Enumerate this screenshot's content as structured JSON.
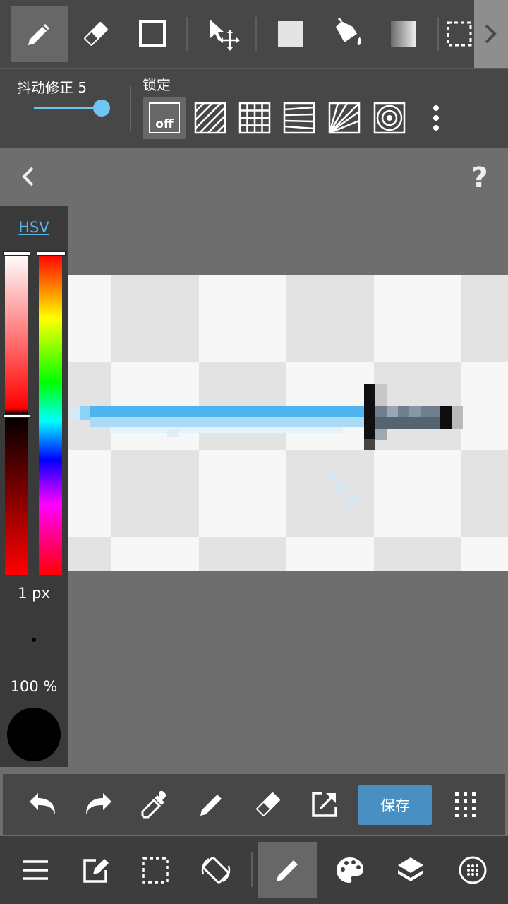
{
  "toolbar": {
    "tools": [
      "pencil-icon",
      "eraser-icon",
      "rectangle-icon",
      "move-icon",
      "fill-square-icon",
      "bucket-icon",
      "gradient-icon",
      "selection-icon"
    ],
    "active_tool": "pencil-icon"
  },
  "options": {
    "stabilizer_label": "抖动修正 5",
    "stabilizer_value": 5,
    "lock_label": "锁定",
    "ruler_off_label": "off",
    "rulers": [
      "off",
      "parallel",
      "grid",
      "perspective",
      "radial",
      "concentric"
    ]
  },
  "color_panel": {
    "mode_label": "HSV",
    "brush_size": "1 px",
    "opacity": "100 %",
    "current_color": "#000000"
  },
  "colors": {
    "accent": "#4a8fc2",
    "link": "#56b6ea",
    "slider": "#6ec6f5"
  },
  "bottom_toolbar": {
    "save_label": "保存",
    "tools": [
      "undo-icon",
      "redo-icon",
      "eyedropper-icon",
      "pen-icon",
      "eraser-icon",
      "export-icon",
      "grid-menu-icon"
    ]
  },
  "bottom_nav": {
    "items": [
      "menu-icon",
      "edit-icon",
      "selection-icon",
      "rotate-icon",
      "brush-icon",
      "palette-icon",
      "layers-icon",
      "materials-icon"
    ],
    "active": "brush-icon"
  }
}
